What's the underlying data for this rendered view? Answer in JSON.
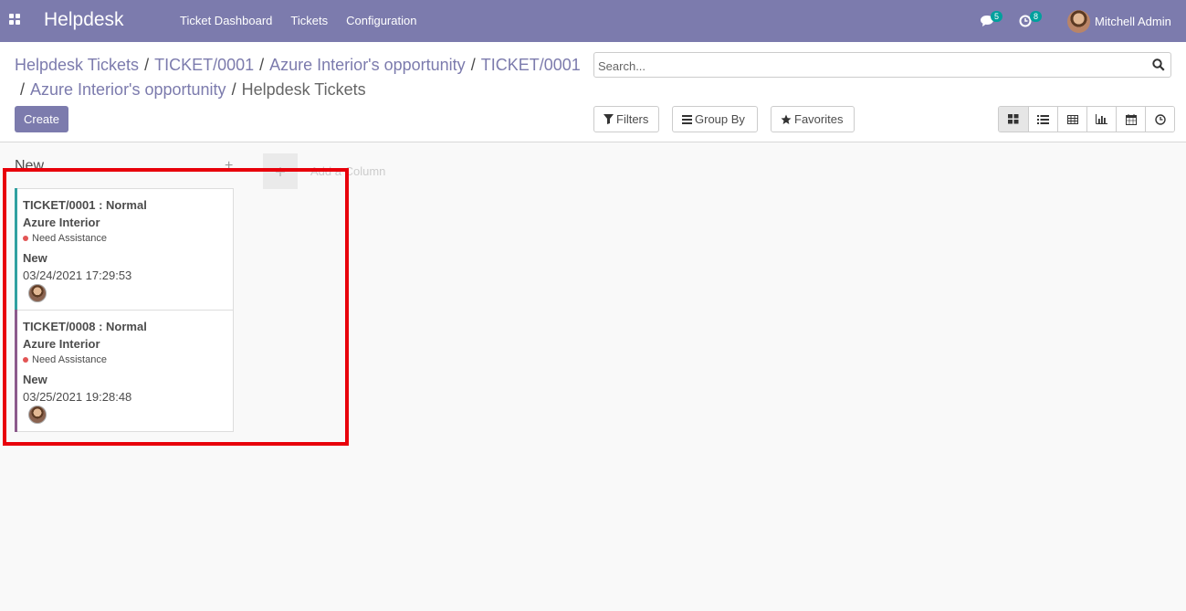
{
  "app": {
    "title": "Helpdesk"
  },
  "menu": [
    "Ticket Dashboard",
    "Tickets",
    "Configuration"
  ],
  "systray": {
    "messages_count": "5",
    "activities_count": "8",
    "user_name": "Mitchell Admin"
  },
  "breadcrumb": {
    "items": [
      "Helpdesk Tickets",
      "TICKET/0001",
      "Azure Interior's opportunity",
      "TICKET/0001",
      "Azure Interior's opportunity"
    ],
    "separator": "/",
    "current": "Helpdesk Tickets"
  },
  "buttons": {
    "create": "Create",
    "filters": "Filters",
    "group_by": "Group By",
    "favorites": "Favorites"
  },
  "search": {
    "placeholder": "Search..."
  },
  "views": [
    "kanban",
    "list",
    "pivot",
    "graph",
    "calendar",
    "activity"
  ],
  "active_view": "kanban",
  "kanban": {
    "column_title": "New",
    "quick_create": "+",
    "add_column_label": "Add a Column",
    "cards": [
      {
        "title": "TICKET/0001 : Normal",
        "partner": "Azure Interior",
        "tag": "Need Assistance",
        "stage": "New",
        "date": "03/24/2021 17:29:53",
        "color": "#30a0a0"
      },
      {
        "title": "TICKET/0008 : Normal",
        "partner": "Azure Interior",
        "tag": "Need Assistance",
        "stage": "New",
        "date": "03/25/2021 19:28:48",
        "color": "#8b5a8b"
      }
    ]
  },
  "colors": {
    "navbar": "#7c7bad",
    "accent": "#7c7bad",
    "highlight": "#e8000b",
    "tag_dot": "#e25555"
  }
}
